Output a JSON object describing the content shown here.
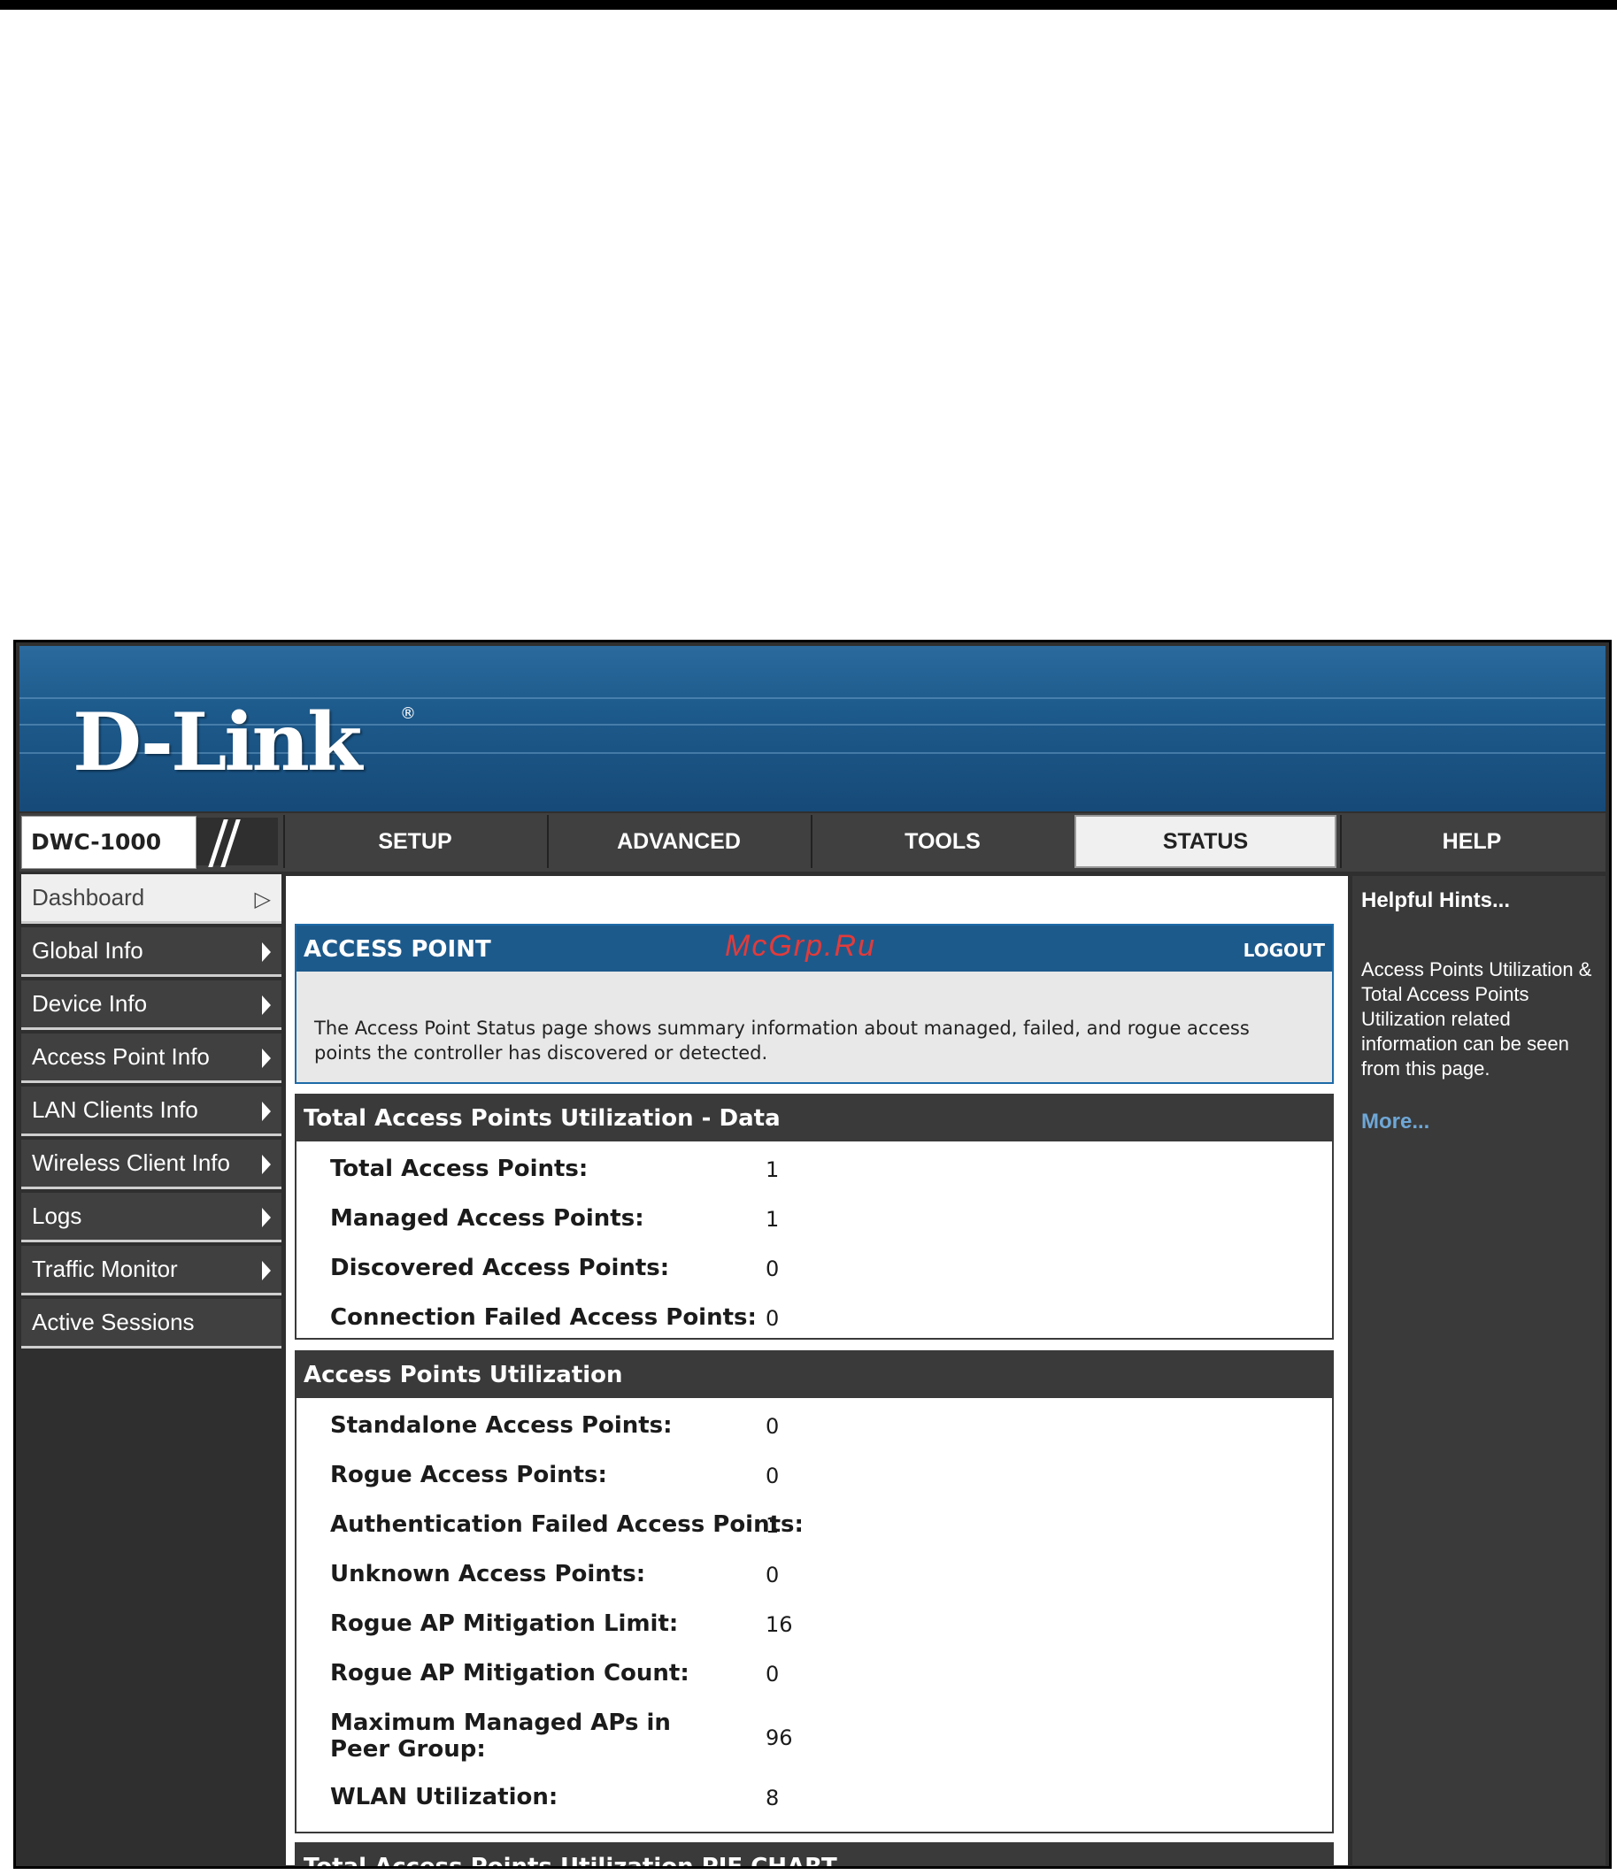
{
  "brand": {
    "logo_text": "D-Link",
    "registered_mark": "®"
  },
  "header": {
    "model": "DWC-1000"
  },
  "tabs": [
    {
      "label": "SETUP"
    },
    {
      "label": "ADVANCED"
    },
    {
      "label": "TOOLS"
    },
    {
      "label": "STATUS",
      "active": true
    },
    {
      "label": "HELP"
    }
  ],
  "sidebar": {
    "items": [
      {
        "label": "Dashboard",
        "active": true
      },
      {
        "label": "Global Info"
      },
      {
        "label": "Device Info"
      },
      {
        "label": "Access Point Info"
      },
      {
        "label": "LAN Clients Info"
      },
      {
        "label": "Wireless Client Info"
      },
      {
        "label": "Logs"
      },
      {
        "label": "Traffic Monitor"
      },
      {
        "label": "Active Sessions"
      }
    ]
  },
  "main": {
    "section_title": "ACCESS POINT",
    "watermark": "McGrp.Ru",
    "logout": "LOGOUT",
    "description": "The Access Point Status page shows summary information about managed, failed, and rogue access points the controller has discovered or detected.",
    "utilization_data": {
      "title": "Total Access Points Utilization - Data",
      "rows": [
        {
          "label": "Total Access Points:",
          "value": "1"
        },
        {
          "label": "Managed Access Points:",
          "value": "1"
        },
        {
          "label": "Discovered Access Points:",
          "value": "0"
        },
        {
          "label": "Connection Failed Access Points:",
          "value": "0"
        }
      ]
    },
    "ap_utilization": {
      "title": "Access Points Utilization",
      "rows": [
        {
          "label": "Standalone Access Points:",
          "value": "0"
        },
        {
          "label": "Rogue Access Points:",
          "value": "0"
        },
        {
          "label": "Authentication Failed Access Points:",
          "value": "1"
        },
        {
          "label": "Unknown Access Points:",
          "value": "0"
        },
        {
          "label": "Rogue AP Mitigation Limit:",
          "value": "16"
        },
        {
          "label": "Rogue AP Mitigation Count:",
          "value": "0"
        },
        {
          "label": "Maximum Managed APs in Peer Group:",
          "value": "96"
        },
        {
          "label": "WLAN Utilization:",
          "value": "8"
        }
      ]
    },
    "pie_chart": {
      "title": "Total Access Points Utilization PIE CHART"
    }
  },
  "help": {
    "title": "Helpful Hints...",
    "text": "Access Points Utilization & Total Access Points Utilization related information can be seen from this page.",
    "more": "More..."
  }
}
